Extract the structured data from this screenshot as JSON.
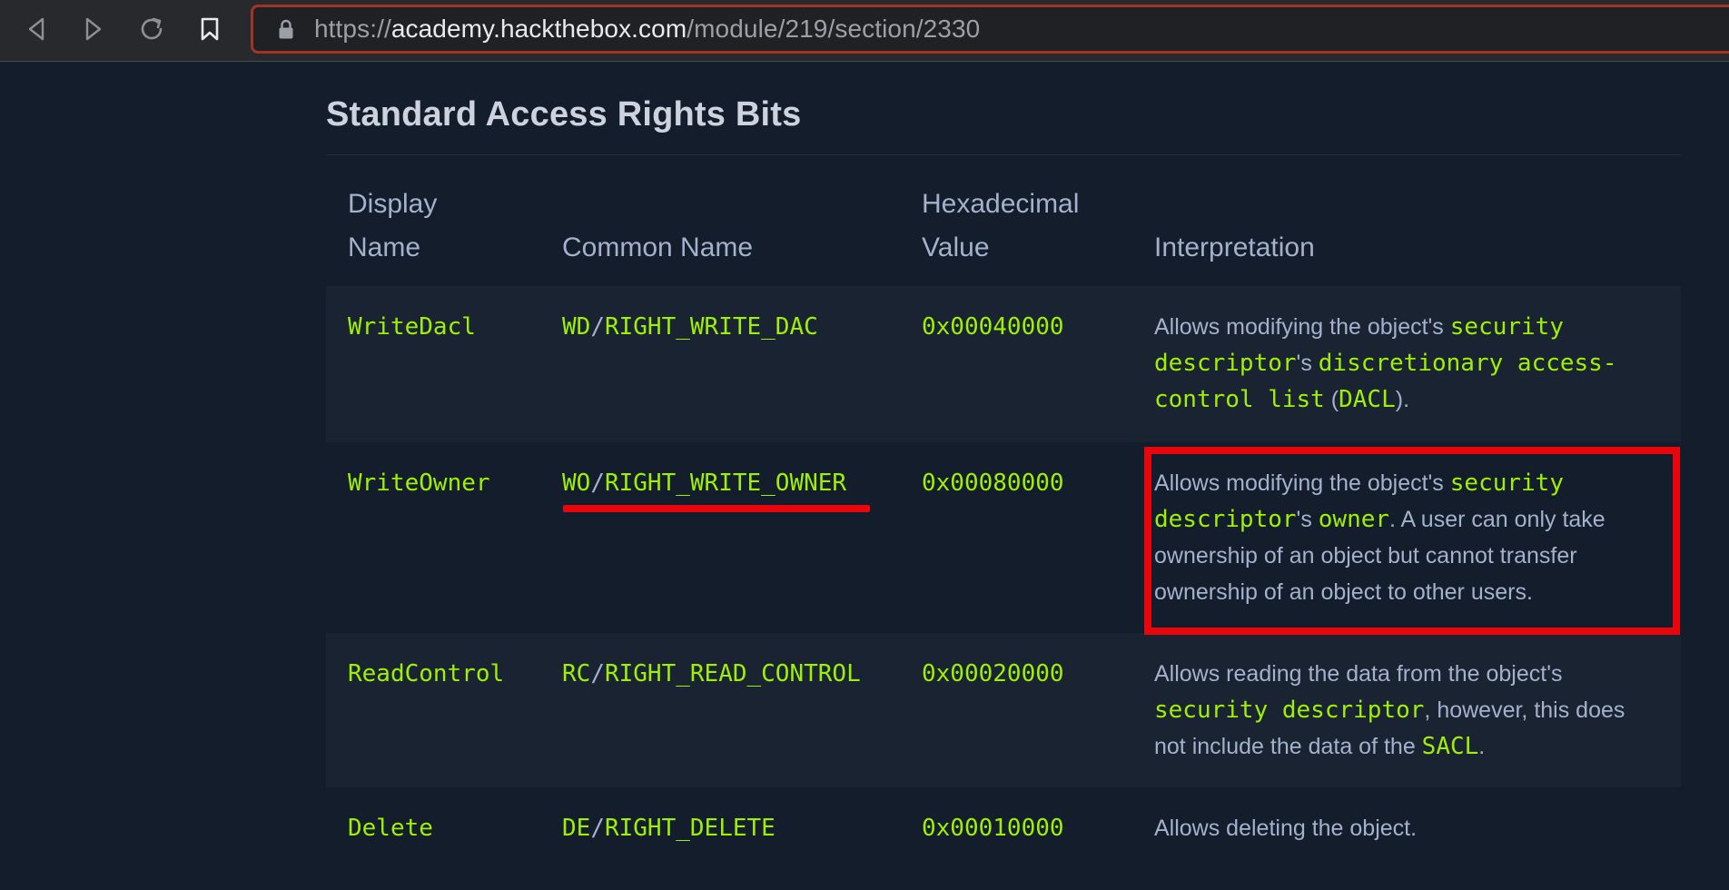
{
  "browser": {
    "url_scheme": "https://",
    "url_host": "academy.hackthebox.com",
    "url_path": "/module/219/section/2330"
  },
  "section": {
    "title": "Standard Access Rights Bits"
  },
  "table": {
    "headers": {
      "display_line1": "Display",
      "display_line2": "Name",
      "common": "Common Name",
      "hex_line1": "Hexadecimal",
      "hex_line2": "Value",
      "interp": "Interpretation"
    },
    "rows": [
      {
        "display": "WriteDacl",
        "common_prefix": "WD",
        "common_sep": "/",
        "common_name": "RIGHT_WRITE_DAC",
        "hex": "0x00040000",
        "interp": {
          "t1": "Allows modifying the object's ",
          "c1": "security descriptor",
          "t2": "'s ",
          "c2": "discretionary access-control list",
          "t3": " (",
          "c3": "DACL",
          "t4": ")."
        }
      },
      {
        "display": "WriteOwner",
        "common_prefix": "WO",
        "common_sep": "/",
        "common_name": "RIGHT_WRITE_OWNER",
        "hex": "0x00080000",
        "interp": {
          "t1": "Allows modifying the object's ",
          "c1": "security descriptor",
          "t2": "'s ",
          "c2": "owner",
          "t3": ". A user can only take ownership of an object but cannot transfer ownership of an object to other users."
        }
      },
      {
        "display": "ReadControl",
        "common_prefix": "RC",
        "common_sep": "/",
        "common_name": "RIGHT_READ_CONTROL",
        "hex": "0x00020000",
        "interp": {
          "t1": "Allows reading the data from the object's ",
          "c1": "security descriptor",
          "t2": ", however, this does not include the data of the ",
          "c2": "SACL",
          "t3": "."
        }
      },
      {
        "display": "Delete",
        "common_prefix": "DE",
        "common_sep": "/",
        "common_name": "RIGHT_DELETE",
        "hex": "0x00010000",
        "interp": {
          "t1": "Allows deleting the object."
        }
      }
    ]
  },
  "annotations": {
    "color": "#e8050b"
  },
  "theme": {
    "background": "#141d2b",
    "accent": "#9fef00",
    "text": "#a4b1cd"
  }
}
